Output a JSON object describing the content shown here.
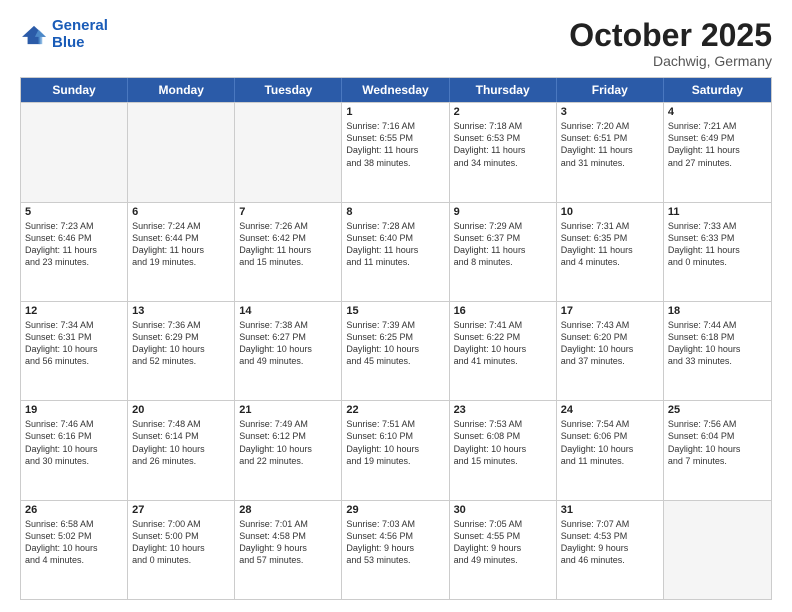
{
  "header": {
    "logo_line1": "General",
    "logo_line2": "Blue",
    "month": "October 2025",
    "location": "Dachwig, Germany"
  },
  "weekdays": [
    "Sunday",
    "Monday",
    "Tuesday",
    "Wednesday",
    "Thursday",
    "Friday",
    "Saturday"
  ],
  "rows": [
    [
      {
        "day": "",
        "info": ""
      },
      {
        "day": "",
        "info": ""
      },
      {
        "day": "",
        "info": ""
      },
      {
        "day": "1",
        "info": "Sunrise: 7:16 AM\nSunset: 6:55 PM\nDaylight: 11 hours\nand 38 minutes."
      },
      {
        "day": "2",
        "info": "Sunrise: 7:18 AM\nSunset: 6:53 PM\nDaylight: 11 hours\nand 34 minutes."
      },
      {
        "day": "3",
        "info": "Sunrise: 7:20 AM\nSunset: 6:51 PM\nDaylight: 11 hours\nand 31 minutes."
      },
      {
        "day": "4",
        "info": "Sunrise: 7:21 AM\nSunset: 6:49 PM\nDaylight: 11 hours\nand 27 minutes."
      }
    ],
    [
      {
        "day": "5",
        "info": "Sunrise: 7:23 AM\nSunset: 6:46 PM\nDaylight: 11 hours\nand 23 minutes."
      },
      {
        "day": "6",
        "info": "Sunrise: 7:24 AM\nSunset: 6:44 PM\nDaylight: 11 hours\nand 19 minutes."
      },
      {
        "day": "7",
        "info": "Sunrise: 7:26 AM\nSunset: 6:42 PM\nDaylight: 11 hours\nand 15 minutes."
      },
      {
        "day": "8",
        "info": "Sunrise: 7:28 AM\nSunset: 6:40 PM\nDaylight: 11 hours\nand 11 minutes."
      },
      {
        "day": "9",
        "info": "Sunrise: 7:29 AM\nSunset: 6:37 PM\nDaylight: 11 hours\nand 8 minutes."
      },
      {
        "day": "10",
        "info": "Sunrise: 7:31 AM\nSunset: 6:35 PM\nDaylight: 11 hours\nand 4 minutes."
      },
      {
        "day": "11",
        "info": "Sunrise: 7:33 AM\nSunset: 6:33 PM\nDaylight: 11 hours\nand 0 minutes."
      }
    ],
    [
      {
        "day": "12",
        "info": "Sunrise: 7:34 AM\nSunset: 6:31 PM\nDaylight: 10 hours\nand 56 minutes."
      },
      {
        "day": "13",
        "info": "Sunrise: 7:36 AM\nSunset: 6:29 PM\nDaylight: 10 hours\nand 52 minutes."
      },
      {
        "day": "14",
        "info": "Sunrise: 7:38 AM\nSunset: 6:27 PM\nDaylight: 10 hours\nand 49 minutes."
      },
      {
        "day": "15",
        "info": "Sunrise: 7:39 AM\nSunset: 6:25 PM\nDaylight: 10 hours\nand 45 minutes."
      },
      {
        "day": "16",
        "info": "Sunrise: 7:41 AM\nSunset: 6:22 PM\nDaylight: 10 hours\nand 41 minutes."
      },
      {
        "day": "17",
        "info": "Sunrise: 7:43 AM\nSunset: 6:20 PM\nDaylight: 10 hours\nand 37 minutes."
      },
      {
        "day": "18",
        "info": "Sunrise: 7:44 AM\nSunset: 6:18 PM\nDaylight: 10 hours\nand 33 minutes."
      }
    ],
    [
      {
        "day": "19",
        "info": "Sunrise: 7:46 AM\nSunset: 6:16 PM\nDaylight: 10 hours\nand 30 minutes."
      },
      {
        "day": "20",
        "info": "Sunrise: 7:48 AM\nSunset: 6:14 PM\nDaylight: 10 hours\nand 26 minutes."
      },
      {
        "day": "21",
        "info": "Sunrise: 7:49 AM\nSunset: 6:12 PM\nDaylight: 10 hours\nand 22 minutes."
      },
      {
        "day": "22",
        "info": "Sunrise: 7:51 AM\nSunset: 6:10 PM\nDaylight: 10 hours\nand 19 minutes."
      },
      {
        "day": "23",
        "info": "Sunrise: 7:53 AM\nSunset: 6:08 PM\nDaylight: 10 hours\nand 15 minutes."
      },
      {
        "day": "24",
        "info": "Sunrise: 7:54 AM\nSunset: 6:06 PM\nDaylight: 10 hours\nand 11 minutes."
      },
      {
        "day": "25",
        "info": "Sunrise: 7:56 AM\nSunset: 6:04 PM\nDaylight: 10 hours\nand 7 minutes."
      }
    ],
    [
      {
        "day": "26",
        "info": "Sunrise: 6:58 AM\nSunset: 5:02 PM\nDaylight: 10 hours\nand 4 minutes."
      },
      {
        "day": "27",
        "info": "Sunrise: 7:00 AM\nSunset: 5:00 PM\nDaylight: 10 hours\nand 0 minutes."
      },
      {
        "day": "28",
        "info": "Sunrise: 7:01 AM\nSunset: 4:58 PM\nDaylight: 9 hours\nand 57 minutes."
      },
      {
        "day": "29",
        "info": "Sunrise: 7:03 AM\nSunset: 4:56 PM\nDaylight: 9 hours\nand 53 minutes."
      },
      {
        "day": "30",
        "info": "Sunrise: 7:05 AM\nSunset: 4:55 PM\nDaylight: 9 hours\nand 49 minutes."
      },
      {
        "day": "31",
        "info": "Sunrise: 7:07 AM\nSunset: 4:53 PM\nDaylight: 9 hours\nand 46 minutes."
      },
      {
        "day": "",
        "info": ""
      }
    ]
  ]
}
